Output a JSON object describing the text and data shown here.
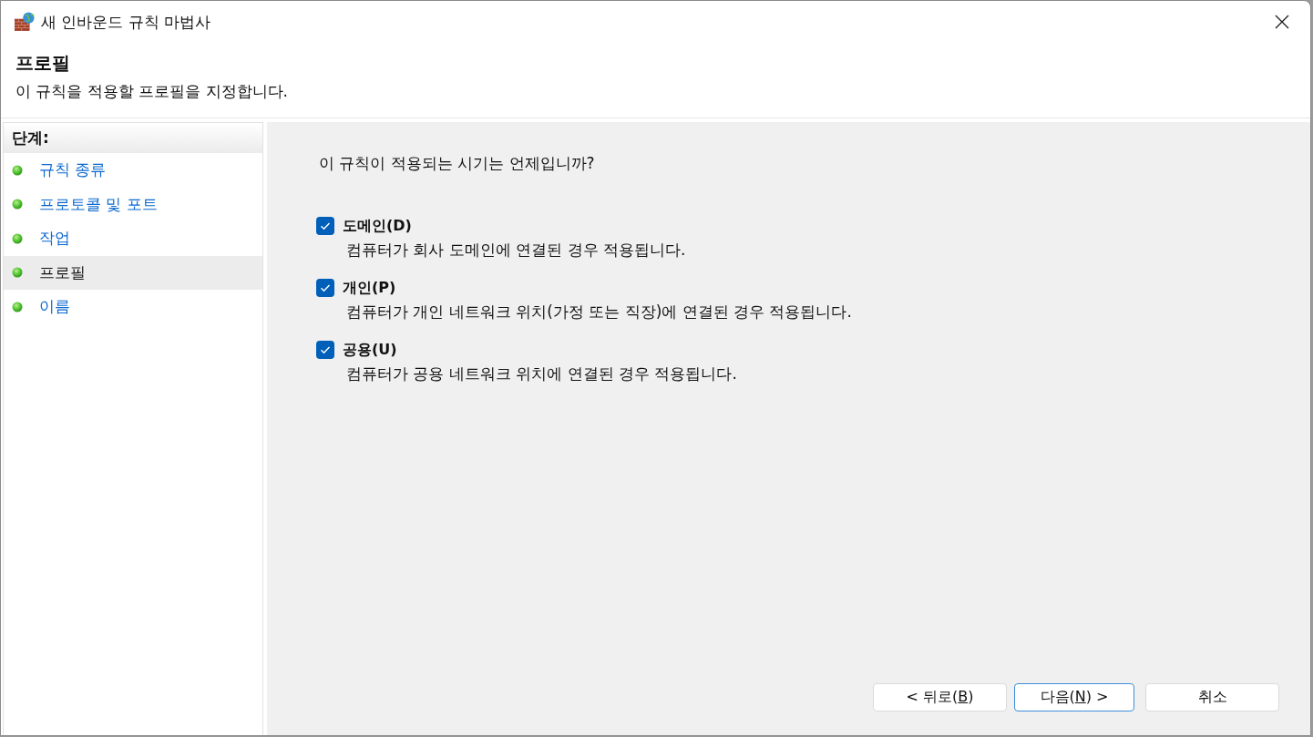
{
  "window": {
    "title": "새 인바운드 규칙 마법사"
  },
  "header": {
    "title": "프로필",
    "subtitle": "이 규칙을 적용할 프로필을 지정합니다."
  },
  "steps": {
    "heading": "단계:",
    "items": [
      {
        "label": "규칙 종류",
        "selected": false
      },
      {
        "label": "프로토콜 및 포트",
        "selected": false
      },
      {
        "label": "작업",
        "selected": false
      },
      {
        "label": "프로필",
        "selected": true
      },
      {
        "label": "이름",
        "selected": false
      }
    ]
  },
  "content": {
    "question": "이 규칙이 적용되는 시기는 언제입니까?",
    "profiles": [
      {
        "label": "도메인(D)",
        "checked": true,
        "description": "컴퓨터가 회사 도메인에 연결된 경우 적용됩니다."
      },
      {
        "label": "개인(P)",
        "checked": true,
        "description": "컴퓨터가 개인 네트워크 위치(가정 또는 직장)에 연결된 경우 적용됩니다."
      },
      {
        "label": "공용(U)",
        "checked": true,
        "description": "컴퓨터가 공용 네트워크 위치에 연결된 경우 적용됩니다."
      }
    ]
  },
  "buttons": [
    {
      "label": "< 뒤로(",
      "access_key": "B",
      "label_end": ")",
      "default": false
    },
    {
      "label": "다음(",
      "access_key": "N",
      "label_end": ") >",
      "default": true
    },
    {
      "label": "취소",
      "default": false
    }
  ]
}
